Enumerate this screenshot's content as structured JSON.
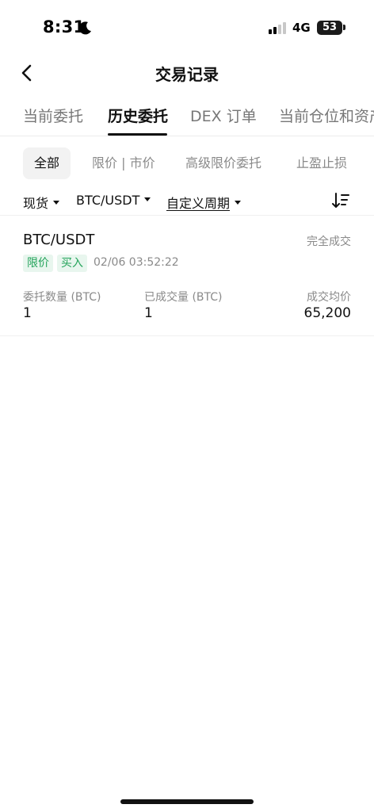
{
  "status_bar": {
    "time": "8:31",
    "network": "4G",
    "battery": "53"
  },
  "header": {
    "title": "交易记录"
  },
  "main_tabs": [
    {
      "label": "当前委托",
      "active": false
    },
    {
      "label": "历史委托",
      "active": true
    },
    {
      "label": "DEX 订单",
      "active": false
    },
    {
      "label": "当前仓位和资产",
      "active": false
    }
  ],
  "sub_tabs": [
    {
      "label": "全部",
      "active": true
    },
    {
      "label": "限价 | 市价",
      "active": false
    },
    {
      "label": "高级限价委托",
      "active": false
    },
    {
      "label": "止盈止损",
      "active": false
    }
  ],
  "filters": {
    "market": "现货",
    "pair": "BTC/USDT",
    "period": "自定义周期"
  },
  "orders": [
    {
      "pair": "BTC/USDT",
      "status": "完全成交",
      "order_type": "限价",
      "side": "买入",
      "time": "02/06 03:52:22",
      "amount_label": "委托数量 (BTC)",
      "amount": "1",
      "filled_label": "已成交量 (BTC)",
      "filled": "1",
      "avg_price_label": "成交均价",
      "avg_price": "65,200"
    }
  ],
  "colors": {
    "accent_green": "#23a35a",
    "tag_bg": "#e8f6ee",
    "muted_text": "#8a8a8a"
  }
}
